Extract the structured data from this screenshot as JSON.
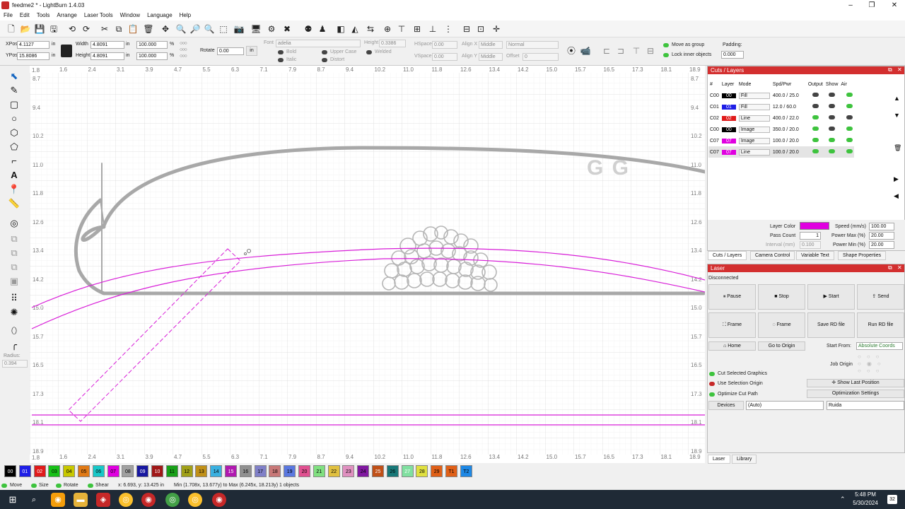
{
  "window": {
    "title": "feedme2 * - LightBurn 1.4.03"
  },
  "menu": [
    "File",
    "Edit",
    "Tools",
    "Arrange",
    "Laser Tools",
    "Window",
    "Language",
    "Help"
  ],
  "props": {
    "xpos_label": "XPos",
    "xpos": "4.1127",
    "ypos_label": "YPos",
    "ypos": "15.8086",
    "unit": "in",
    "width_label": "Width",
    "width": "4.8091",
    "height_label": "Height",
    "height": "4.8091",
    "pct_w": "100.000",
    "pct_h": "100.000",
    "pct": "%",
    "rotate_label": "Rotate",
    "rotate": "0.00",
    "rot_unit": "in",
    "font_label": "Font",
    "font": "adelia",
    "fheight_label": "Height",
    "fheight": "0.3386",
    "hspace_label": "HSpace",
    "hspace": "0.00",
    "vspace_label": "VSpace",
    "vspace": "0.00",
    "alignx_label": "Align X",
    "alignx": "Middle",
    "aligny_label": "Align Y",
    "aligny": "Middle",
    "normal": "Normal",
    "offset_label": "Offset",
    "offset": "0",
    "bold": "Bold",
    "italic": "Italic",
    "upper": "Upper Case",
    "distort": "Distort",
    "welded": "Welded",
    "move_group": "Move as group",
    "lock_inner": "Lock inner objects",
    "padding_label": "Padding:",
    "padding": "0.000"
  },
  "ruler": {
    "top": [
      "1.6",
      "2.4",
      "3.1",
      "3.9",
      "4.7",
      "5.5",
      "6.3",
      "7.1",
      "7.9",
      "8.7",
      "9.4",
      "10.2",
      "11.0",
      "11.8",
      "12.6",
      "13.4",
      "14.2",
      "15.0",
      "15.7",
      "16.5",
      "17.3",
      "18.1",
      "18.9"
    ],
    "side": [
      "8.7",
      "9.4",
      "10.2",
      "11.0",
      "11.8",
      "12.6",
      "13.4",
      "14.2",
      "15.0",
      "15.7",
      "16.5",
      "17.3",
      "18.1",
      "18.9"
    ],
    "corner_top": "1.8",
    "corner_bottom": "1.8"
  },
  "canvas": {
    "sample_text": "G G"
  },
  "left": {
    "radius_label": "Radius:",
    "radius": "0.394"
  },
  "cuts": {
    "title": "Cuts / Layers",
    "headers": [
      "#",
      "Layer",
      "Mode",
      "Spd/Pwr",
      "Output",
      "Show",
      "Air"
    ],
    "rows": [
      {
        "num": "C00",
        "layer": "00",
        "color": "#000000",
        "mode": "Fill",
        "sp": "400.0 / 25.0"
      },
      {
        "num": "C01",
        "layer": "01",
        "color": "#1e1ee6",
        "mode": "Fill",
        "sp": "12.0 / 60.0"
      },
      {
        "num": "C02",
        "layer": "02",
        "color": "#e01b1b",
        "mode": "Line",
        "sp": "400.0 / 22.0"
      },
      {
        "num": "C00",
        "layer": "00",
        "color": "#000000",
        "mode": "Image",
        "sp": "350.0 / 20.0"
      },
      {
        "num": "C07",
        "layer": "07",
        "color": "#e000e0",
        "mode": "Image",
        "sp": "100.0 / 20.0"
      },
      {
        "num": "C07",
        "layer": "07",
        "color": "#e000e0",
        "mode": "Line",
        "sp": "100.0 / 20.0"
      }
    ],
    "layer_color_label": "Layer Color",
    "speed_label": "Speed (mm/s)",
    "speed": "100.00",
    "pass_label": "Pass Count",
    "pass": "1",
    "powermax_label": "Power Max (%)",
    "powermax": "20.00",
    "interval_label": "Interval (mm)",
    "interval": "0.100",
    "powermin_label": "Power Min (%)",
    "powermin": "20.00",
    "tabs": [
      "Cuts / Layers",
      "Camera Control",
      "Variable Text",
      "Shape Properties"
    ]
  },
  "laser": {
    "title": "Laser",
    "status": "Disconnected",
    "pause": "Pause",
    "stop": "Stop",
    "start": "Start",
    "send": "Send",
    "frame1": "Frame",
    "frame2": "Frame",
    "save_rd": "Save RD file",
    "run_rd": "Run RD file",
    "home": "Home",
    "goto": "Go to Origin",
    "start_from_label": "Start From:",
    "start_from": "Absolute Coords",
    "job_origin": "Job Origin",
    "cut_selected": "Cut Selected Graphics",
    "use_sel_origin": "Use Selection Origin",
    "show_last": "Show Last Position",
    "optimize": "Optimize Cut Path",
    "opt_settings": "Optimization Settings",
    "devices": "Devices",
    "auto": "(Auto)",
    "ruida": "Ruida",
    "tabs": [
      "Laser",
      "Library"
    ]
  },
  "palette": [
    "00",
    "01",
    "02",
    "03",
    "04",
    "05",
    "06",
    "07",
    "08",
    "09",
    "10",
    "11",
    "12",
    "13",
    "14",
    "15",
    "16",
    "17",
    "18",
    "19",
    "20",
    "21",
    "22",
    "23",
    "24",
    "25",
    "26",
    "27",
    "28",
    "29",
    "T1",
    "T2"
  ],
  "palette_colors": [
    "#000000",
    "#1e1ee6",
    "#e01b1b",
    "#18c018",
    "#c8c800",
    "#e07a16",
    "#18c8c8",
    "#e000e0",
    "#a0a0a0",
    "#1818a0",
    "#a01818",
    "#18a018",
    "#a0a018",
    "#c09018",
    "#3ab0e0",
    "#b01ab0",
    "#909090",
    "#8080c8",
    "#c87878",
    "#5a78e0",
    "#e05090",
    "#80e080",
    "#e0c040",
    "#e090c0",
    "#8018a0",
    "#c05018",
    "#187878",
    "#80e0a0",
    "#e0e040",
    "#e06018",
    "#e0e0e0"
  ],
  "status": {
    "move": "Move",
    "size": "Size",
    "rotate": "Rotate",
    "shear": "Shear",
    "coords": "x: 6.693, y: 13.425 in",
    "minmax": "Min (1.708x, 13.677y) to Max (6.245x, 18.213y)  1 objects"
  },
  "clock": {
    "time": "5:48 PM",
    "date": "5/30/2024"
  }
}
